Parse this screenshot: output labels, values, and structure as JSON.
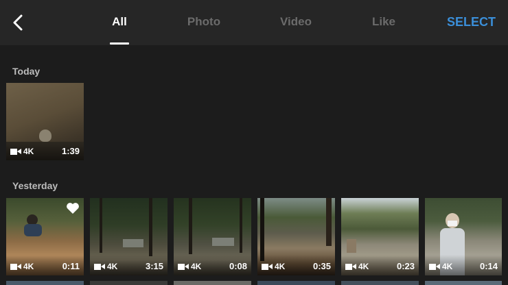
{
  "header": {
    "tabs": [
      {
        "label": "All",
        "active": true
      },
      {
        "label": "Photo",
        "active": false
      },
      {
        "label": "Video",
        "active": false
      },
      {
        "label": "Like",
        "active": false
      }
    ],
    "select_label": "SELECT",
    "accent_color": "#3b8fd9"
  },
  "sections": [
    {
      "label": "Today",
      "items": [
        {
          "resolution": "4K",
          "duration": "1:39",
          "liked": false
        }
      ]
    },
    {
      "label": "Yesterday",
      "items": [
        {
          "resolution": "4K",
          "duration": "0:11",
          "liked": true
        },
        {
          "resolution": "4K",
          "duration": "3:15",
          "liked": false
        },
        {
          "resolution": "4K",
          "duration": "0:08",
          "liked": false
        },
        {
          "resolution": "4K",
          "duration": "0:35",
          "liked": false
        },
        {
          "resolution": "4K",
          "duration": "0:23",
          "liked": false
        },
        {
          "resolution": "4K",
          "duration": "0:14",
          "liked": false
        }
      ]
    }
  ]
}
